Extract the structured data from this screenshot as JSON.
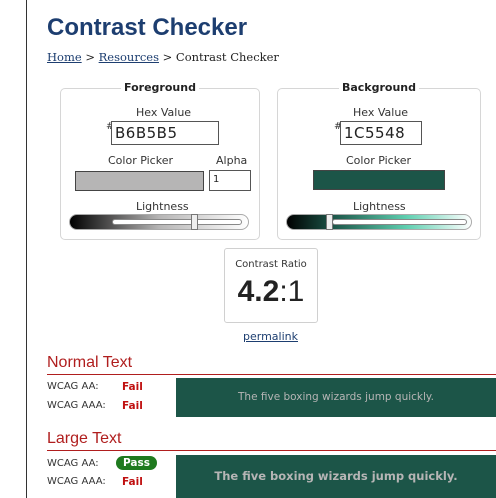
{
  "page": {
    "title": "Contrast Checker",
    "breadcrumb": {
      "home": "Home",
      "sep1": ">",
      "resources": "Resources",
      "sep2": ">",
      "current": "Contrast Checker"
    }
  },
  "foreground": {
    "legend": "Foreground",
    "hex_label": "Hex Value",
    "hash": "#",
    "hex_value": "B6B5B5",
    "picker_label": "Color Picker",
    "alpha_label": "Alpha",
    "alpha_value": "1",
    "lightness_label": "Lightness",
    "color": "#b6b5b5",
    "lightness_level": 0.71
  },
  "background": {
    "legend": "Background",
    "hex_label": "Hex Value",
    "hash": "#",
    "hex_value": "1C5548",
    "picker_label": "Color Picker",
    "lightness_label": "Lightness",
    "color": "#1c5548",
    "lightness_level": 0.22
  },
  "ratio": {
    "label": "Contrast Ratio",
    "value_bold": "4.2",
    "value_rest": ":1",
    "permalink": "permalink"
  },
  "normal_text": {
    "heading": "Normal Text",
    "aa_label": "WCAG AA:",
    "aa_result": "Fail",
    "aaa_label": "WCAG AAA:",
    "aaa_result": "Fail",
    "sample": "The five boxing wizards jump quickly."
  },
  "large_text": {
    "heading": "Large Text",
    "aa_label": "WCAG AA:",
    "aa_result": "Pass",
    "aaa_label": "WCAG AAA:",
    "aaa_result": "Fail",
    "sample": "The five boxing wizards jump quickly."
  },
  "colors": {
    "accent_red": "#b01e1e",
    "link_blue": "#1d3e70",
    "pass_green": "#1f7a1f"
  }
}
